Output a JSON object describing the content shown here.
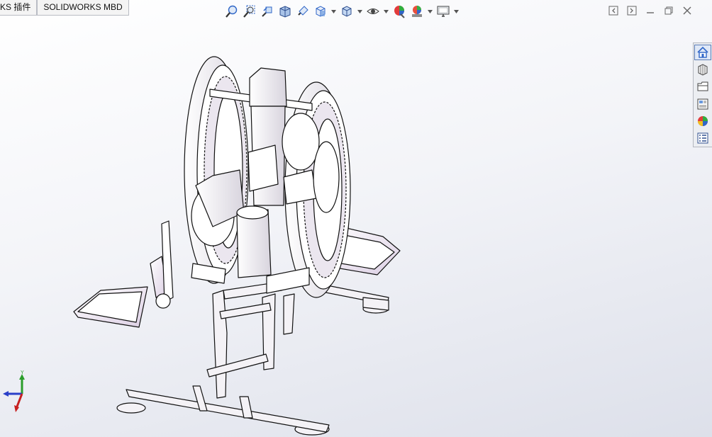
{
  "tabs": [
    {
      "label": "KS 插件"
    },
    {
      "label": "SOLIDWORKS MBD"
    }
  ],
  "heads_up_toolbar": [
    {
      "icon": "zoom-to-fit-icon"
    },
    {
      "icon": "zoom-to-area-icon"
    },
    {
      "icon": "previous-view-icon"
    },
    {
      "icon": "section-view-icon"
    },
    {
      "icon": "dynamic-annotation-views-icon"
    },
    {
      "icon": "view-orientation-icon",
      "dropdown": true
    },
    {
      "icon": "display-style-icon",
      "dropdown": true
    },
    {
      "icon": "hide-show-items-icon",
      "dropdown": true
    },
    {
      "icon": "edit-appearance-icon"
    },
    {
      "icon": "apply-scene-icon",
      "dropdown": true
    },
    {
      "icon": "view-settings-icon",
      "dropdown": true
    }
  ],
  "window_controls": [
    {
      "icon": "tile-left-icon"
    },
    {
      "icon": "tile-right-icon"
    },
    {
      "icon": "minimize-icon"
    },
    {
      "icon": "restore-icon"
    },
    {
      "icon": "close-icon"
    }
  ],
  "task_pane": [
    {
      "icon": "solidworks-resources-icon",
      "active": true
    },
    {
      "icon": "design-library-icon"
    },
    {
      "icon": "file-explorer-icon"
    },
    {
      "icon": "view-palette-icon"
    },
    {
      "icon": "appearances-scenes-icon"
    },
    {
      "icon": "custom-properties-icon"
    }
  ],
  "triad": {
    "y_label": "Y"
  },
  "colors": {
    "accent": "#2f66c8",
    "model_shade": "#f1eef4",
    "model_edge": "#111111",
    "axis_x": "#c62020",
    "axis_y": "#2a9d2a",
    "axis_z": "#2a3fc8"
  }
}
